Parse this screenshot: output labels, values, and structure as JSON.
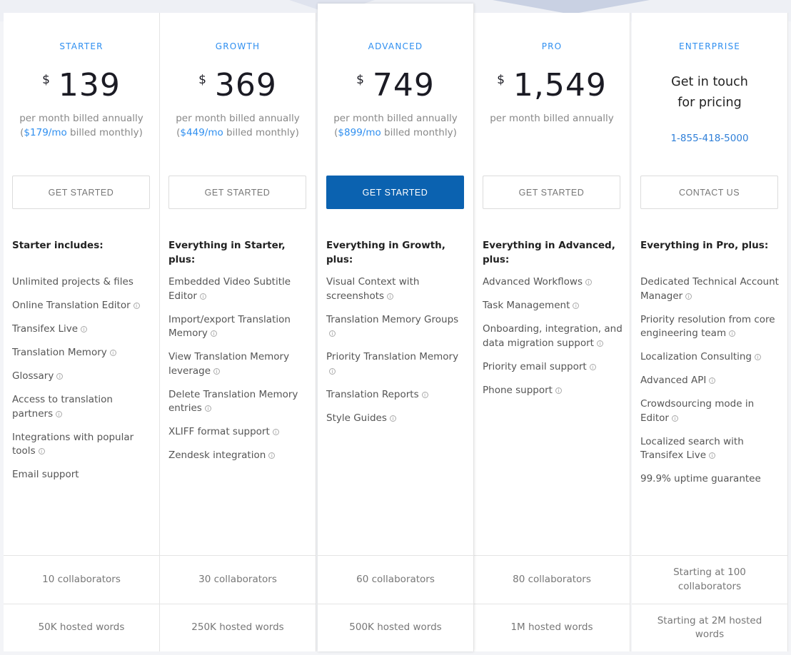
{
  "info_icon": "info-circle-icon",
  "accent": "#2f8ff0",
  "primary_button_color": "#0b62b0",
  "plans": [
    {
      "name": "STARTER",
      "currency": "$",
      "price": "139",
      "billing": "per month billed annually",
      "monthly_open": "(",
      "monthly_price": "$179/mo",
      "monthly_rest": " billed monthly)",
      "button": "GET STARTED",
      "heading": "Starter includes:",
      "features": [
        {
          "text": "Unlimited projects & files",
          "info": false
        },
        {
          "text": "Online Translation Editor",
          "info": true
        },
        {
          "text": "Transifex Live",
          "info": true
        },
        {
          "text": "Translation Memory",
          "info": true
        },
        {
          "text": "Glossary",
          "info": true
        },
        {
          "text": "Access to translation partners",
          "info": true
        },
        {
          "text": "Integrations with popular tools",
          "info": true
        },
        {
          "text": "Email support",
          "info": false
        }
      ],
      "collaborators": "10 collaborators",
      "words": "50K hosted words"
    },
    {
      "name": "GROWTH",
      "currency": "$",
      "price": "369",
      "billing": "per month billed annually",
      "monthly_open": "(",
      "monthly_price": "$449/mo",
      "monthly_rest": " billed monthly)",
      "button": "GET STARTED",
      "heading": "Everything in Starter, plus:",
      "features": [
        {
          "text": "Embedded Video Subtitle Editor",
          "info": true
        },
        {
          "text": "Import/export Translation Memory",
          "info": true
        },
        {
          "text": "View Translation Memory leverage",
          "info": true
        },
        {
          "text": "Delete Translation Memory entries",
          "info": true
        },
        {
          "text": "XLIFF format support",
          "info": true
        },
        {
          "text": "Zendesk integration",
          "info": true
        }
      ],
      "collaborators": "30 collaborators",
      "words": "250K hosted words"
    },
    {
      "name": "ADVANCED",
      "currency": "$",
      "price": "749",
      "billing": "per month billed annually",
      "monthly_open": "(",
      "monthly_price": "$899/mo",
      "monthly_rest": " billed monthly)",
      "button": "GET STARTED",
      "featured": true,
      "heading": "Everything in Growth, plus:",
      "features": [
        {
          "text": "Visual Context with screenshots",
          "info": true
        },
        {
          "text": "Translation Memory Groups",
          "info": true
        },
        {
          "text": "Priority Translation Memory",
          "info": true
        },
        {
          "text": "Translation Reports",
          "info": true
        },
        {
          "text": "Style Guides",
          "info": true
        }
      ],
      "collaborators": "60 collaborators",
      "words": "500K hosted words"
    },
    {
      "name": "PRO",
      "currency": "$",
      "price": "1,549",
      "billing": "per month billed annually",
      "button": "GET STARTED",
      "heading": "Everything in Advanced, plus:",
      "features": [
        {
          "text": "Advanced Workflows",
          "info": true
        },
        {
          "text": "Task Management",
          "info": true
        },
        {
          "text": "Onboarding, integration, and data migration support",
          "info": true
        },
        {
          "text": "Priority email support",
          "info": true
        },
        {
          "text": "Phone support",
          "info": true
        }
      ],
      "collaborators": "80 collaborators",
      "words": "1M hosted words"
    },
    {
      "name": "ENTERPRISE",
      "contact_line1": "Get in touch",
      "contact_line2": "for pricing",
      "phone": "1-855-418-5000",
      "button": "CONTACT US",
      "heading": "Everything in Pro, plus:",
      "features": [
        {
          "text": "Dedicated Technical Account Manager",
          "info": true
        },
        {
          "text": "Priority resolution from core engineering team",
          "info": true
        },
        {
          "text": "Localization Consulting",
          "info": true
        },
        {
          "text": "Advanced API",
          "info": true
        },
        {
          "text": "Crowdsourcing mode in Editor",
          "info": true
        },
        {
          "text": "Localized search with Transifex Live",
          "info": true
        },
        {
          "text": "99.9% uptime guarantee",
          "info": false
        }
      ],
      "collaborators": "Starting at 100 collaborators",
      "words": "Starting at 2M hosted words"
    }
  ]
}
